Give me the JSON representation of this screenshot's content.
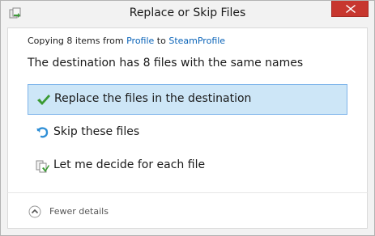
{
  "window": {
    "title": "Replace or Skip Files",
    "app_icon": "copy-files-icon",
    "close_icon": "close-icon"
  },
  "copy_status": {
    "prefix": "Copying 8 items from",
    "source": "Profile",
    "joiner": "to",
    "destination": "SteamProfile"
  },
  "headline": "The destination has 8 files with the same names",
  "options": [
    {
      "label": "Replace the files in the destination",
      "icon": "checkmark-icon",
      "selected": true
    },
    {
      "label": "Skip these files",
      "icon": "skip-arrow-icon",
      "selected": false
    },
    {
      "label": "Let me decide for each file",
      "icon": "compare-files-icon",
      "selected": false
    }
  ],
  "details_toggle": {
    "label": "Fewer details",
    "icon": "chevron-up-circle-icon"
  },
  "colors": {
    "selection_fill": "#cde6f7",
    "selection_border": "#7eb4ea",
    "link": "#0a63b8",
    "close": "#c7372f"
  }
}
